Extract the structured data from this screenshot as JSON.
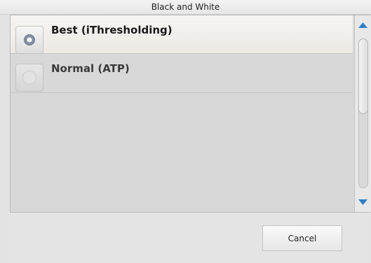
{
  "dialog": {
    "title": "Black and White"
  },
  "options": [
    {
      "label": "Best (iThresholding)",
      "selected": true
    },
    {
      "label": "Normal (ATP)",
      "selected": false
    }
  ],
  "footer": {
    "cancel_label": "Cancel"
  },
  "colors": {
    "scroll_arrow": "#2f7fc4",
    "selected_row": "#f4f2ee",
    "list_background": "#d8d8d8"
  },
  "icons": {
    "scroll_up": "triangle-up-icon",
    "scroll_down": "triangle-down-icon"
  }
}
